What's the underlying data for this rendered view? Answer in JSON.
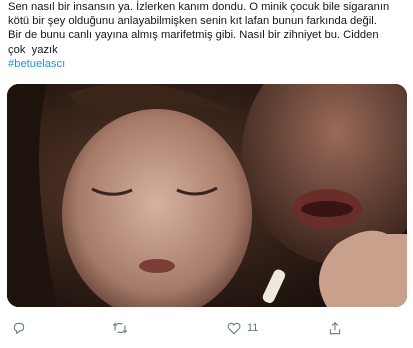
{
  "tweet": {
    "lines": [
      "Sen nasıl bir insansın ya. İzlerken kanım dondu. O minik çocuk bile sigaranın",
      "kötü bir şey olduğunu anlayabilmişken senin kıt lafan bunun farkında değil.",
      "Bir de bunu canlı yayına almış marifetmiş gibi. Nasıl bir zihniyet bu. Cidden",
      "çok  yazık"
    ],
    "hashtag": "#betuelascı"
  },
  "actions": {
    "reply_icon": "reply-icon",
    "retweet_icon": "retweet-icon",
    "like_icon": "heart-icon",
    "like_count": "11",
    "share_icon": "share-icon"
  },
  "colors": {
    "text": "#14171a",
    "hashtag": "#1b95e0",
    "icon": "#657786"
  }
}
